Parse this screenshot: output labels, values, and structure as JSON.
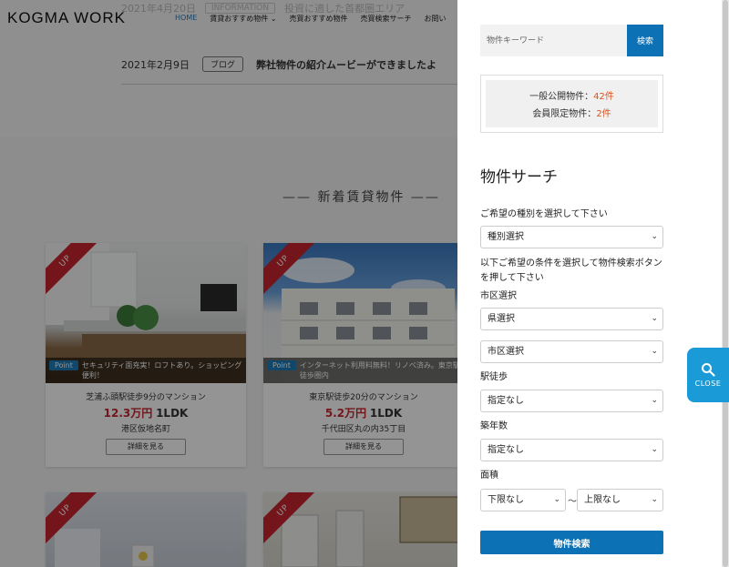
{
  "site": {
    "logo": "KOGMA WORK",
    "nav": [
      "HOME",
      "賃貸おすすめ物件 ⌄",
      "売買おすすめ物件",
      "売買検索サーチ",
      "お問い"
    ]
  },
  "news": {
    "ghost": {
      "date": "2021年4月20日",
      "tag": "INFORMATION",
      "title": "投資に適した首都圏エリア"
    },
    "item": {
      "date": "2021年2月9日",
      "tag": "ブログ",
      "title": "弊社物件の紹介ムービーができましたよ"
    }
  },
  "section_title": "—— 新着賃貸物件 ——",
  "cards": [
    {
      "ribbon": "UP",
      "point_label": "Point",
      "point_text": "セキュリティ面充実！ロフトあり。ショッピング便利！",
      "name": "芝浦ふ頭駅徒歩9分のマンション",
      "price": "12.3万円",
      "layout": "1LDK",
      "address": "港区仮地名町",
      "detail": "詳細を見る"
    },
    {
      "ribbon": "UP",
      "point_label": "Point",
      "point_text": "インターネット利用料無料！リノベ済み。東京駅徒歩圏内",
      "name": "東京駅徒歩20分のマンション",
      "price": "5.2万円",
      "layout": "1LDK",
      "address": "千代田区丸の内35丁目",
      "detail": "詳細を見る"
    },
    {
      "ribbon": "UP"
    },
    {
      "ribbon": "UP"
    }
  ],
  "drawer": {
    "keyword_placeholder": "物件キーワード",
    "keyword_button": "検索",
    "counts": {
      "public_label": "一般公開物件：",
      "public_value": "42件",
      "member_label": "会員限定物件：",
      "member_value": "2件"
    },
    "search_title": "物件サーチ",
    "type_label": "ご希望の種別を選択して下さい",
    "type_select": "種別選択",
    "condition_label": "以下ご希望の条件を選択して物件検索ボタンを押して下さい",
    "city_label": "市区選択",
    "prefecture_select": "県選択",
    "city_select": "市区選択",
    "walk_label": "駅徒歩",
    "walk_select": "指定なし",
    "age_label": "築年数",
    "age_select": "指定なし",
    "area_label": "面積",
    "area_min": "下限なし",
    "area_tilde": "〜",
    "area_max": "上限なし",
    "submit": "物件検索"
  },
  "close_tab": {
    "label": "CLOSE",
    "icon": "search-icon"
  }
}
